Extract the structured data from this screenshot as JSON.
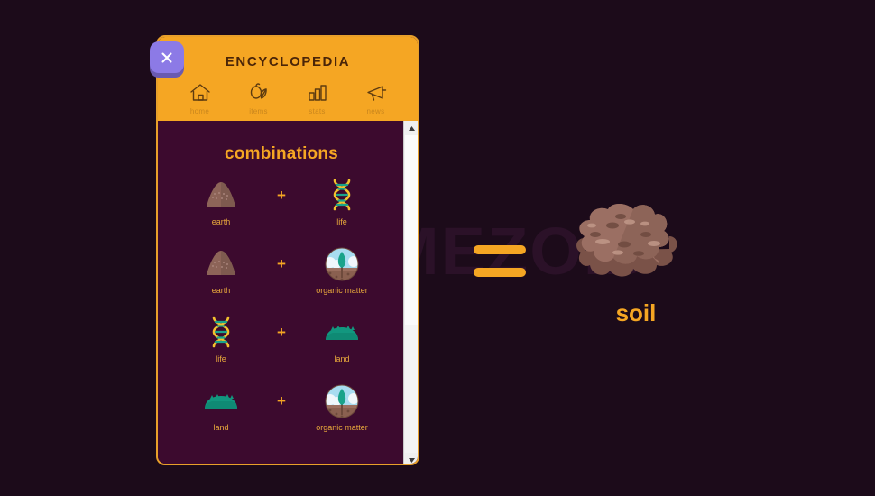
{
  "window": {
    "title": "ENCYCLOPEDIA",
    "close_icon": "close-x-icon",
    "accent_color": "#f5a623",
    "panel_background": "#3c0a2e",
    "page_background": "#1c0b1a",
    "close_button_color": "#8c7ae6"
  },
  "watermark": {
    "text": "GAMEZOID",
    "color": "#2b1128"
  },
  "nav": {
    "items": [
      {
        "label": "home",
        "icon": "home-icon"
      },
      {
        "label": "items",
        "icon": "items-icon"
      },
      {
        "label": "stats",
        "icon": "stats-icon"
      },
      {
        "label": "news",
        "icon": "megaphone-icon"
      }
    ]
  },
  "content": {
    "section_title": "combinations",
    "plus_symbol": "+",
    "rows": [
      {
        "left": {
          "label": "earth",
          "icon": "earth-mound-icon"
        },
        "right": {
          "label": "life",
          "icon": "dna-helix-icon"
        }
      },
      {
        "left": {
          "label": "earth",
          "icon": "earth-mound-icon"
        },
        "right": {
          "label": "organic matter",
          "icon": "organic-matter-icon"
        }
      },
      {
        "left": {
          "label": "life",
          "icon": "dna-helix-icon"
        },
        "right": {
          "label": "land",
          "icon": "land-hill-icon"
        }
      },
      {
        "left": {
          "label": "land",
          "icon": "land-hill-icon"
        },
        "right": {
          "label": "organic matter",
          "icon": "organic-matter-icon"
        }
      }
    ]
  },
  "result": {
    "label": "soil",
    "icon": "soil-patch-icon",
    "equals_symbol": "="
  },
  "scrollbar": {
    "up_arrow_icon": "chevron-up-icon",
    "down_arrow_icon": "chevron-down-icon"
  }
}
